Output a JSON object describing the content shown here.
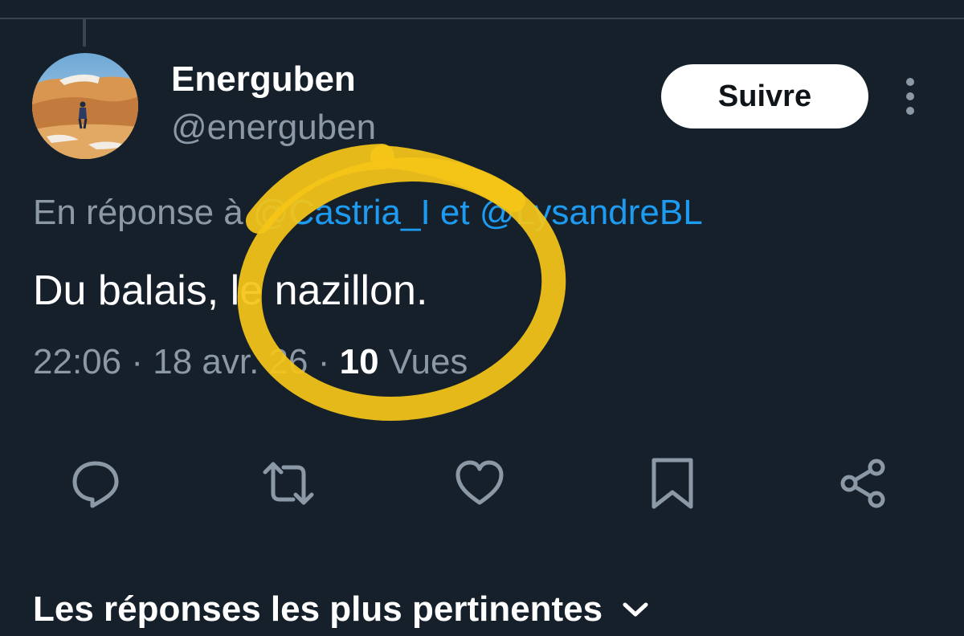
{
  "author": {
    "display_name": "Energuben",
    "handle": "@energuben"
  },
  "follow_button": {
    "label": "Suivre"
  },
  "reply_context": {
    "prefix": "En réponse à ",
    "mention_1": "@Castria_I",
    "connector": " et ",
    "mention_2": "@LysandreBL"
  },
  "tweet": {
    "text": "Du balais, le nazillon.",
    "time": "22:06",
    "separator": " · ",
    "date": "18 avr. 26",
    "views_count": "10",
    "views_label": " Vues"
  },
  "actions": [
    {
      "name": "reply",
      "icon": "reply-icon"
    },
    {
      "name": "retweet",
      "icon": "retweet-icon"
    },
    {
      "name": "like",
      "icon": "heart-icon"
    },
    {
      "name": "bookmark",
      "icon": "bookmark-icon"
    },
    {
      "name": "share",
      "icon": "share-icon"
    }
  ],
  "replies_section": {
    "title": "Les réponses les plus pertinentes"
  },
  "colors": {
    "background": "#15202b",
    "text_primary": "#ffffff",
    "text_secondary": "#8b98a5",
    "link": "#1d9bf0",
    "annotation": "#f5c518"
  }
}
